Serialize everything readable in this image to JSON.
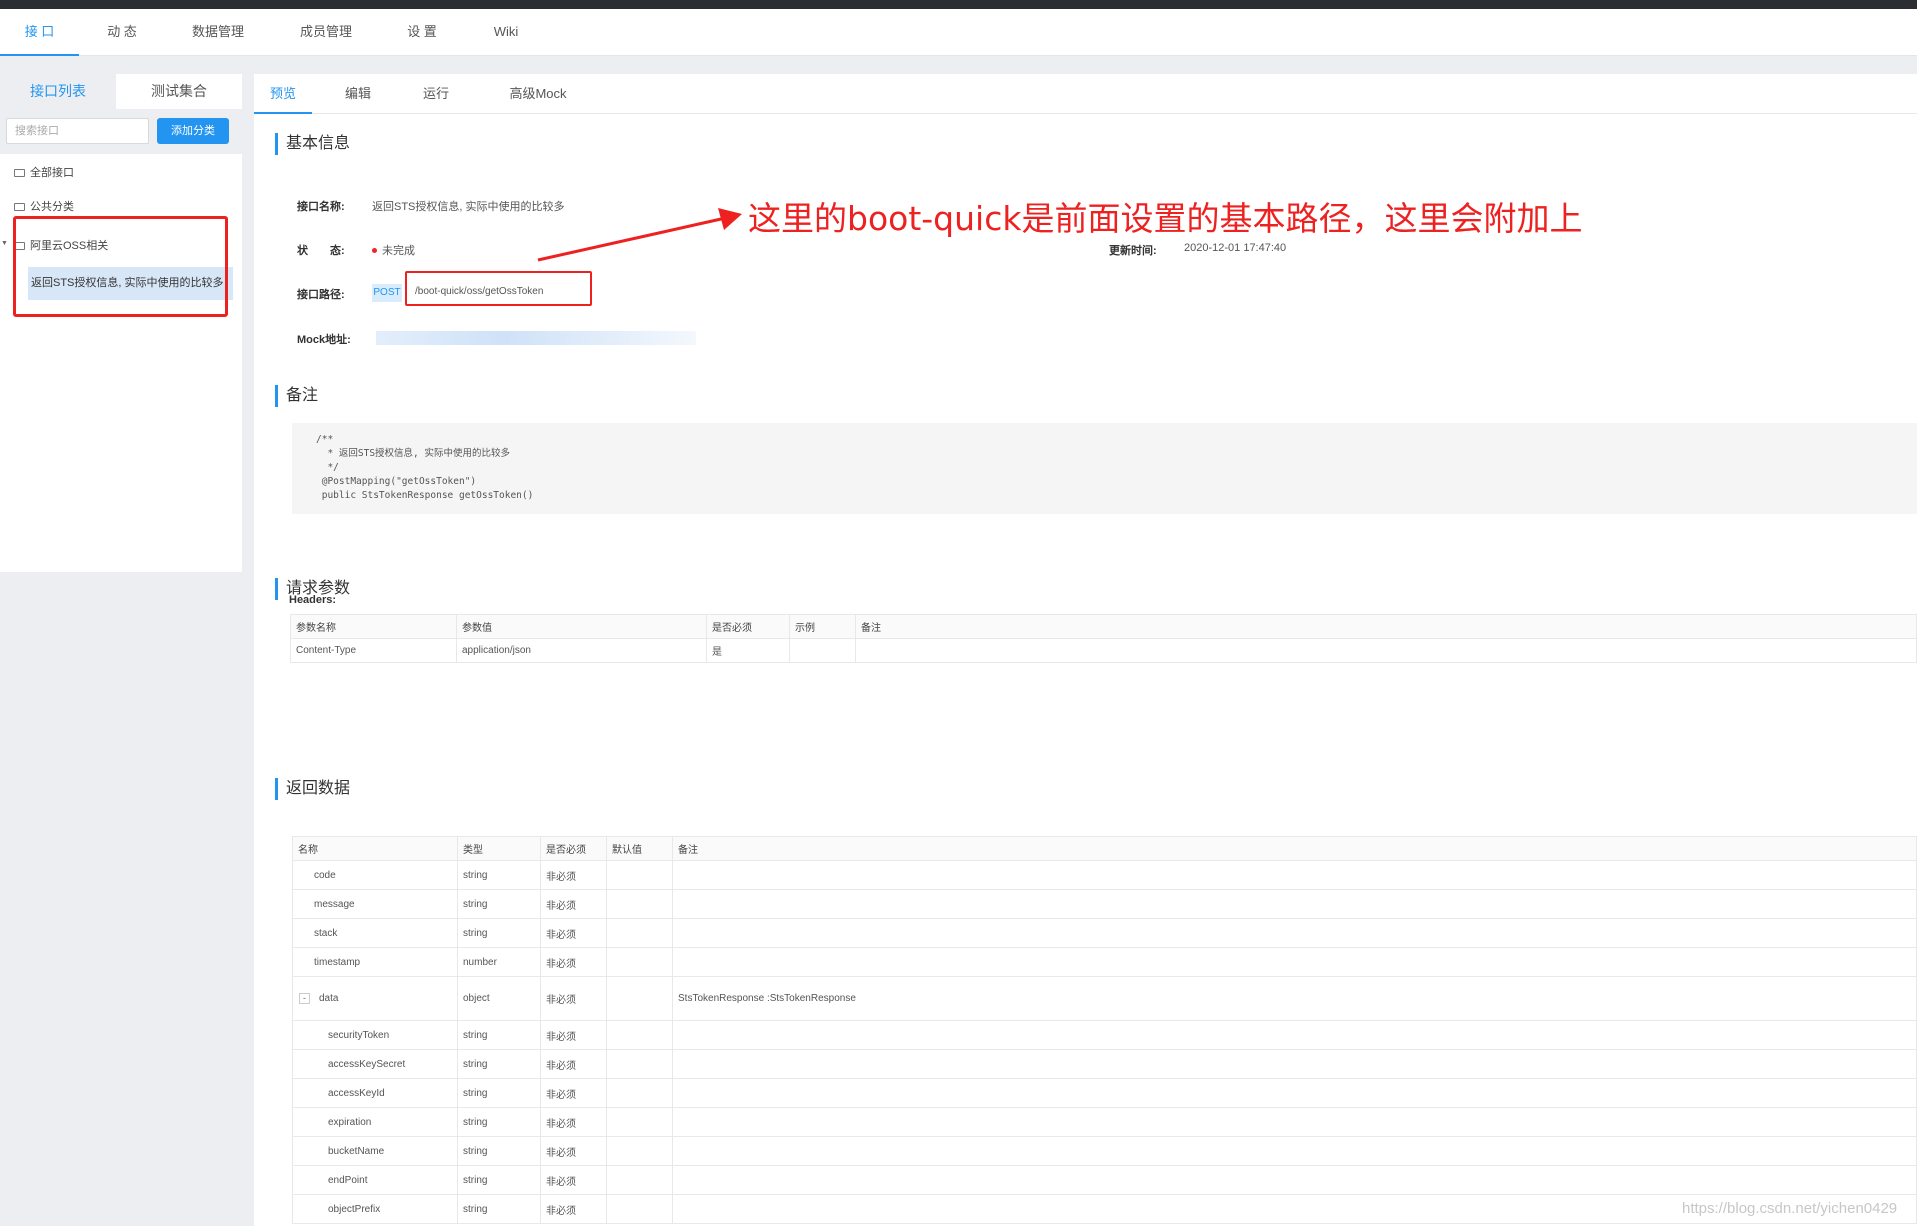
{
  "topnav": [
    "接 口",
    "动 态",
    "数据管理",
    "成员管理",
    "设 置",
    "Wiki"
  ],
  "sidebar": {
    "tabs": [
      "接口列表",
      "测试集合"
    ],
    "search_placeholder": "搜索接口",
    "add_button": "添加分类",
    "tree": [
      "全部接口",
      "公共分类",
      "阿里云OSS相关"
    ],
    "selected_item": "返回STS授权信息, 实际中使用的比较多"
  },
  "content_tabs": [
    "预览",
    "编辑",
    "运行",
    "高级Mock"
  ],
  "basic": {
    "title": "基本信息",
    "name_label": "接口名称:",
    "name_value": "返回STS授权信息, 实际中使用的比较多",
    "status_label": "状　　态:",
    "status_value": "未完成",
    "update_label": "更新时间:",
    "update_value": "2020-12-01 17:47:40",
    "path_label": "接口路径:",
    "method": "POST",
    "path": "/boot-quick/oss/getOssToken",
    "mock_label": "Mock地址:"
  },
  "note": {
    "title": "备注",
    "code": "/**\n  * 返回STS授权信息, 实际中使用的比较多\n  */\n @PostMapping(\"getOssToken\")\n public StsTokenResponse getOssToken()"
  },
  "request": {
    "title": "请求参数",
    "headers_label": "Headers:",
    "columns": [
      "参数名称",
      "参数值",
      "是否必须",
      "示例",
      "备注"
    ],
    "rows": [
      [
        "Content-Type",
        "application/json",
        "是",
        "",
        ""
      ]
    ]
  },
  "response": {
    "title": "返回数据",
    "columns": [
      "名称",
      "类型",
      "是否必须",
      "默认值",
      "备注"
    ],
    "rows": [
      {
        "name": "code",
        "type": "string",
        "required": "非必须",
        "note": "",
        "level": 1
      },
      {
        "name": "message",
        "type": "string",
        "required": "非必须",
        "note": "",
        "level": 1
      },
      {
        "name": "stack",
        "type": "string",
        "required": "非必须",
        "note": "",
        "level": 1
      },
      {
        "name": "timestamp",
        "type": "number",
        "required": "非必须",
        "note": "",
        "level": 1
      },
      {
        "name": "data",
        "type": "object",
        "required": "非必须",
        "note": "StsTokenResponse :StsTokenResponse",
        "level": 0,
        "toggle": "-"
      },
      {
        "name": "securityToken",
        "type": "string",
        "required": "非必须",
        "note": "",
        "level": 2
      },
      {
        "name": "accessKeySecret",
        "type": "string",
        "required": "非必须",
        "note": "",
        "level": 2
      },
      {
        "name": "accessKeyId",
        "type": "string",
        "required": "非必须",
        "note": "",
        "level": 2
      },
      {
        "name": "expiration",
        "type": "string",
        "required": "非必须",
        "note": "",
        "level": 2
      },
      {
        "name": "bucketName",
        "type": "string",
        "required": "非必须",
        "note": "",
        "level": 2
      },
      {
        "name": "endPoint",
        "type": "string",
        "required": "非必须",
        "note": "",
        "level": 2
      },
      {
        "name": "objectPrefix",
        "type": "string",
        "required": "非必须",
        "note": "",
        "level": 2
      }
    ]
  },
  "annotation": "这里的boot-quick是前面设置的基本路径，这里会附加上",
  "watermark": "https://blog.csdn.net/yichen0429",
  "colors": {
    "accent": "#2395f1",
    "annotation": "#ee2121"
  }
}
